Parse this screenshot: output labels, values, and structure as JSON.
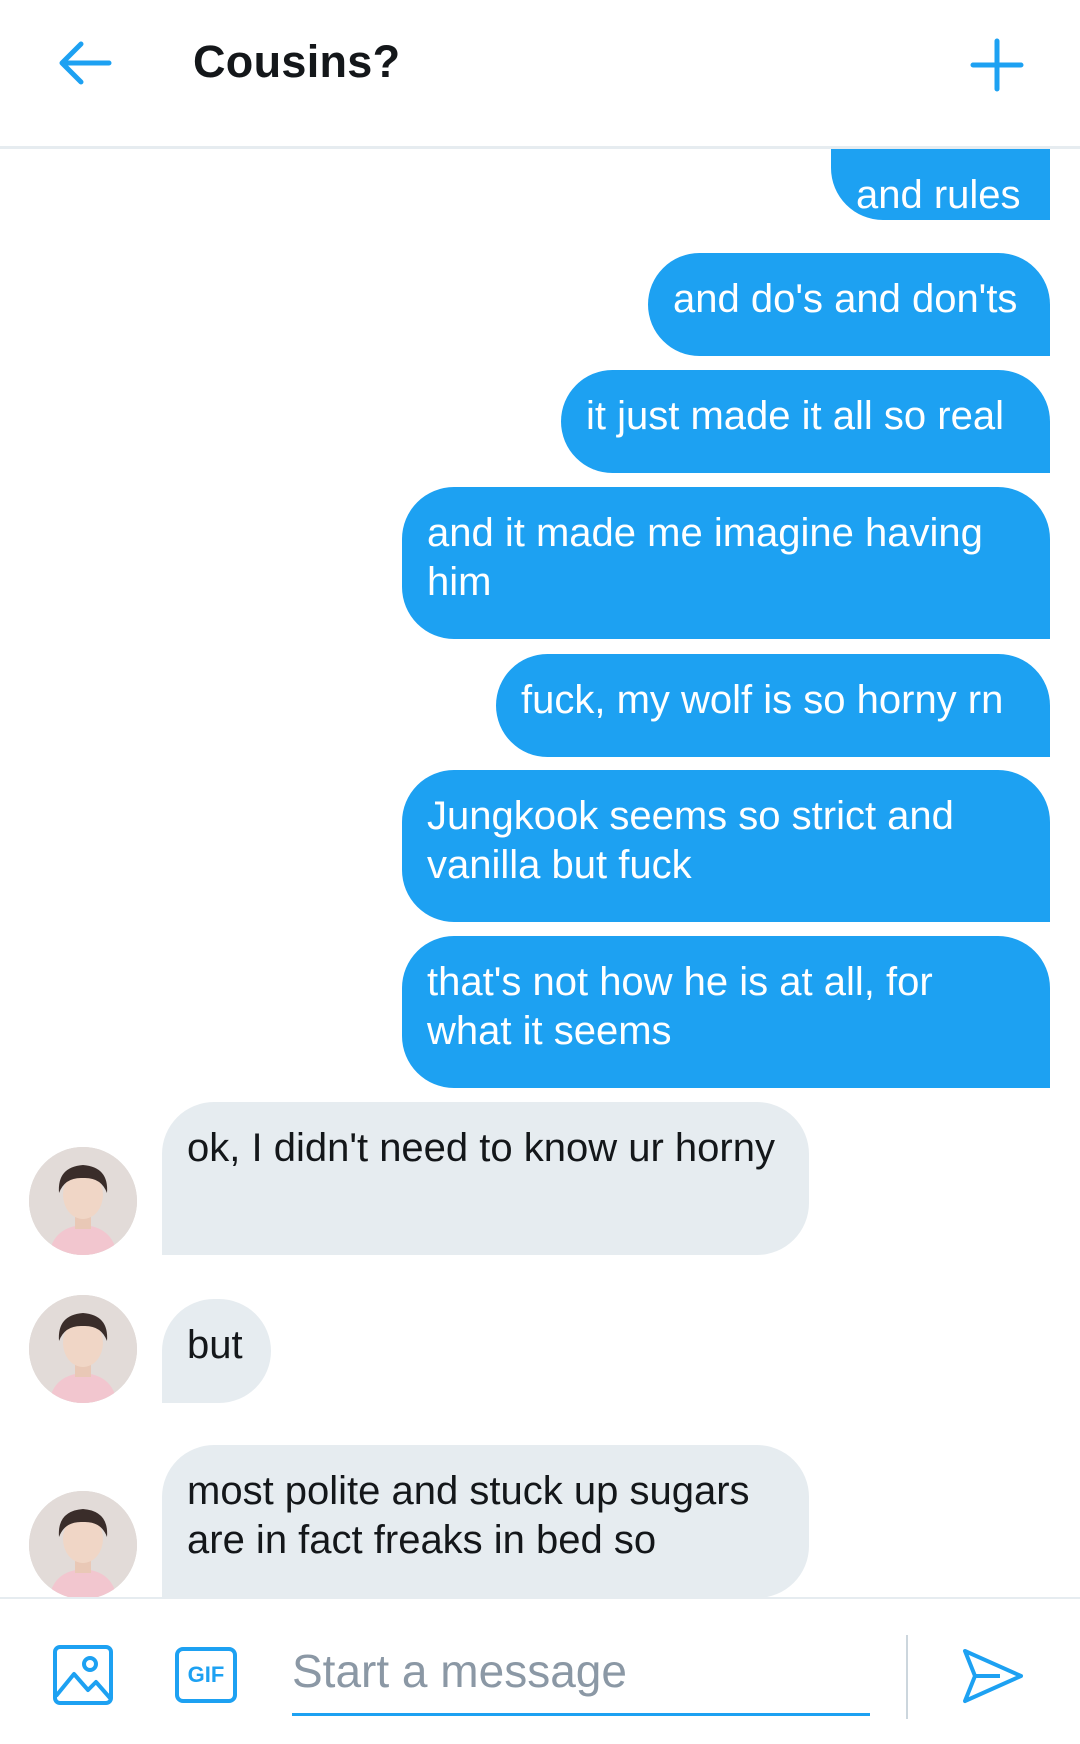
{
  "header": {
    "title": "Cousins?"
  },
  "colors": {
    "accent": "#1da1f2",
    "incoming_bubble": "#e6ecf0",
    "text": "#14171a"
  },
  "messages": [
    {
      "direction": "outgoing",
      "text": "and rules"
    },
    {
      "direction": "outgoing",
      "text": "and do's and don'ts"
    },
    {
      "direction": "outgoing",
      "text": "it just made it all so real"
    },
    {
      "direction": "outgoing",
      "text": "and it made me imagine having him"
    },
    {
      "direction": "outgoing",
      "text": "fuck, my wolf is so horny rn"
    },
    {
      "direction": "outgoing",
      "text": "Jungkook seems so strict and vanilla but fuck"
    },
    {
      "direction": "outgoing",
      "text": "that's not how he is at all, for what it seems"
    },
    {
      "direction": "incoming",
      "text": "ok, I didn't need to know ur horny"
    },
    {
      "direction": "incoming",
      "text": "but"
    },
    {
      "direction": "incoming",
      "text": "most polite and stuck up sugars are in fact freaks in bed so"
    }
  ],
  "composer": {
    "placeholder": "Start a message",
    "value": "",
    "gif_label": "GIF"
  },
  "icons": {
    "back": "arrow-left-icon",
    "add": "plus-icon",
    "media": "image-icon",
    "gif": "gif-icon",
    "send": "send-icon"
  }
}
